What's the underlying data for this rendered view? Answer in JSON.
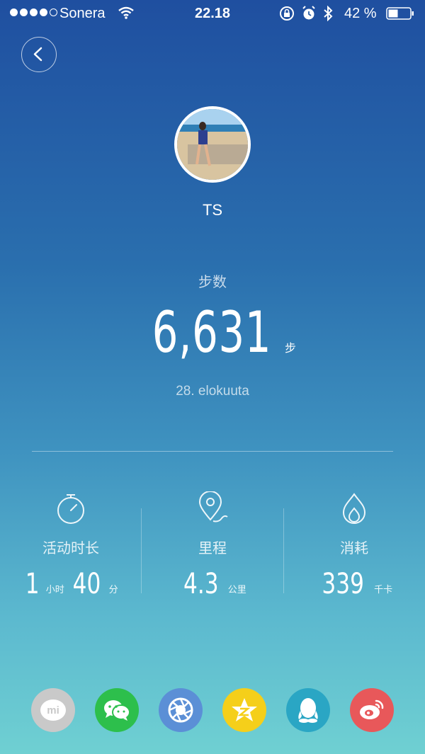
{
  "status_bar": {
    "carrier": "Sonera",
    "time": "22.18",
    "battery": "42 %",
    "signal_bars": 4,
    "battery_level": 0.42
  },
  "profile": {
    "name": "TS"
  },
  "steps": {
    "label": "步数",
    "value": "6,631",
    "unit": "步",
    "date": "28. elokuuta"
  },
  "stats": {
    "activity": {
      "label": "活动时长",
      "hours": "1",
      "hours_unit": "小时",
      "minutes": "40",
      "minutes_unit": "分",
      "icon": "stopwatch-icon"
    },
    "distance": {
      "label": "里程",
      "value": "4.3",
      "unit": "公里",
      "icon": "location-pin-icon"
    },
    "calories": {
      "label": "消耗",
      "value": "339",
      "unit": "千卡",
      "icon": "flame-icon"
    }
  },
  "share": {
    "mi_text": "mi",
    "colors": {
      "mi": "#c9c9c9",
      "wechat": "#2dbf4c",
      "moments": "#5b8fd6",
      "qzone": "#f5cf1a",
      "qq": "#2aa6c4",
      "weibo": "#e8585a"
    }
  }
}
